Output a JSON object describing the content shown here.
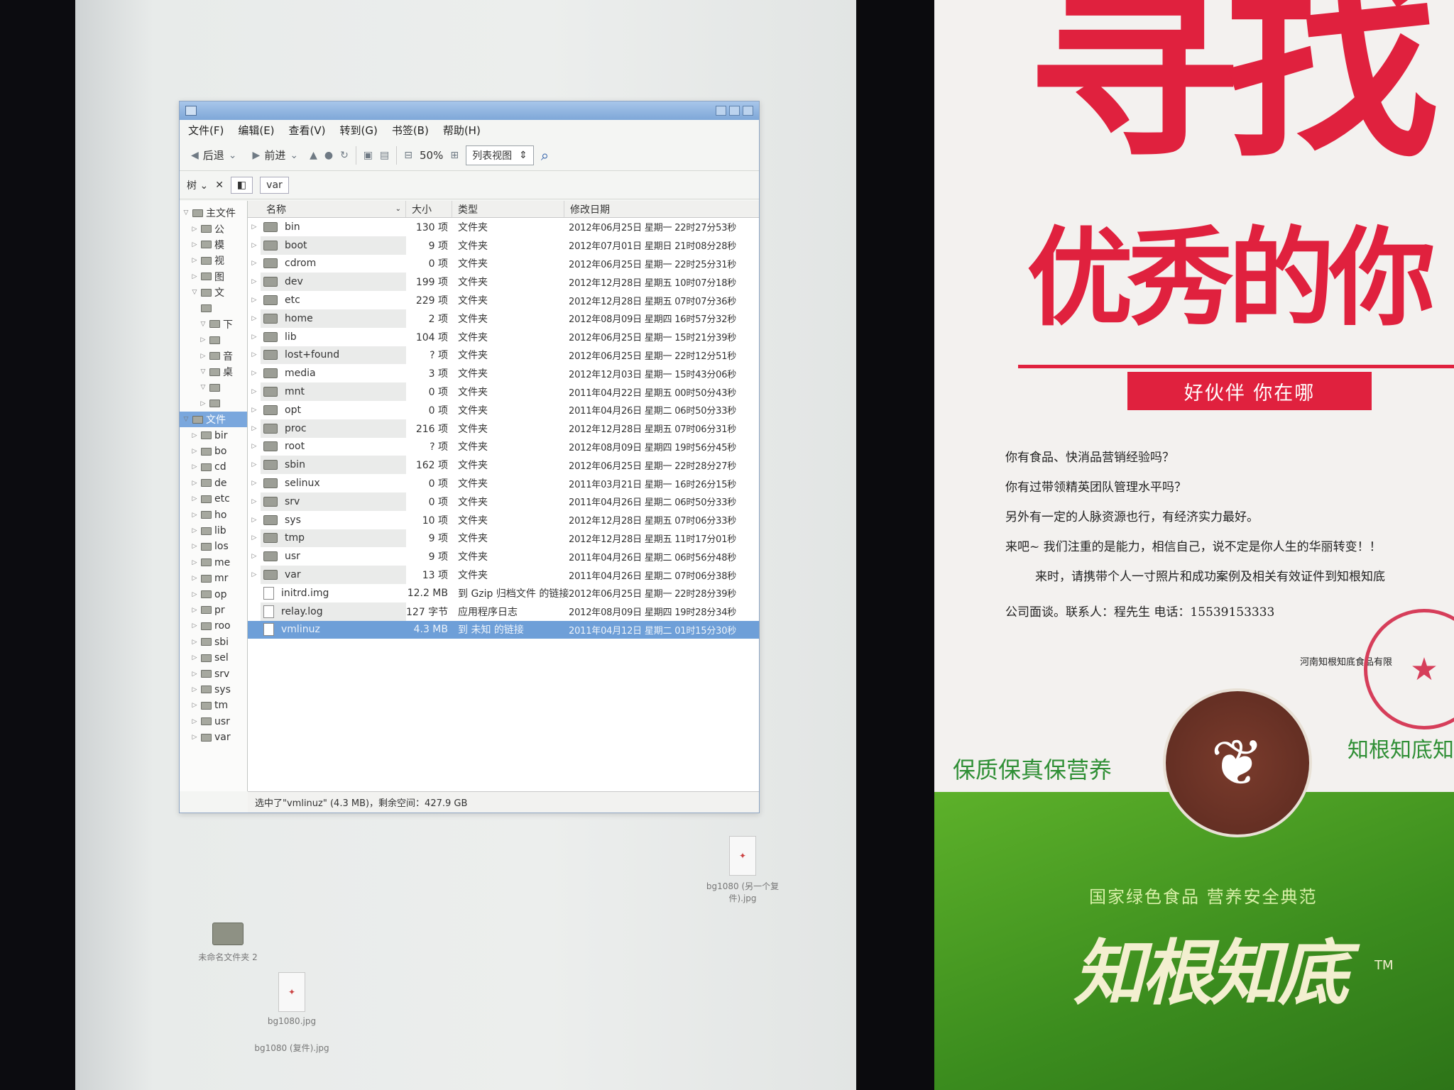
{
  "menubar": [
    "文件(F)",
    "编辑(E)",
    "查看(V)",
    "转到(G)",
    "书签(B)",
    "帮助(H)"
  ],
  "toolbar": {
    "back": "后退",
    "forward": "前进",
    "zoom": "50%",
    "view_mode": "列表视图"
  },
  "location": {
    "sidebar_mode": "树",
    "path": "var"
  },
  "tree": [
    {
      "label": "主文件",
      "expander": "▽"
    },
    {
      "label": "公",
      "expander": "▷"
    },
    {
      "label": "模",
      "expander": "▷"
    },
    {
      "label": "视",
      "expander": "▷"
    },
    {
      "label": "图",
      "expander": "▷"
    },
    {
      "label": "文",
      "expander": "▽"
    },
    {
      "label": "",
      "expander": ""
    },
    {
      "label": "下",
      "expander": "▽"
    },
    {
      "label": "",
      "expander": "▷"
    },
    {
      "label": "音",
      "expander": "▷"
    },
    {
      "label": "桌",
      "expander": "▽"
    },
    {
      "label": "",
      "expander": "▽"
    },
    {
      "label": "",
      "expander": "▷"
    },
    {
      "label": "文件",
      "expander": "▽"
    },
    {
      "label": "bir",
      "expander": "▷"
    },
    {
      "label": "bo",
      "expander": "▷"
    },
    {
      "label": "cd",
      "expander": "▷"
    },
    {
      "label": "de",
      "expander": "▷"
    },
    {
      "label": "etc",
      "expander": "▷"
    },
    {
      "label": "ho",
      "expander": "▷"
    },
    {
      "label": "lib",
      "expander": "▷"
    },
    {
      "label": "los",
      "expander": "▷"
    },
    {
      "label": "me",
      "expander": "▷"
    },
    {
      "label": "mr",
      "expander": "▷"
    },
    {
      "label": "op",
      "expander": "▷"
    },
    {
      "label": "pr",
      "expander": "▷"
    },
    {
      "label": "roo",
      "expander": "▷"
    },
    {
      "label": "sbi",
      "expander": "▷"
    },
    {
      "label": "sel",
      "expander": "▷"
    },
    {
      "label": "srv",
      "expander": "▷"
    },
    {
      "label": "sys",
      "expander": "▷"
    },
    {
      "label": "tm",
      "expander": "▷"
    },
    {
      "label": "usr",
      "expander": "▷"
    },
    {
      "label": "var",
      "expander": "▷"
    }
  ],
  "columns": {
    "name": "名称",
    "size": "大小",
    "type": "类型",
    "date": "修改日期"
  },
  "files": [
    {
      "name": "bin",
      "size": "130 项",
      "type": "文件夹",
      "date": "2012年06月25日 星期一 22时27分53秒"
    },
    {
      "name": "boot",
      "size": "9 项",
      "type": "文件夹",
      "date": "2012年07月01日 星期日 21时08分28秒"
    },
    {
      "name": "cdrom",
      "size": "0 项",
      "type": "文件夹",
      "date": "2012年06月25日 星期一 22时25分31秒"
    },
    {
      "name": "dev",
      "size": "199 项",
      "type": "文件夹",
      "date": "2012年12月28日 星期五 10时07分18秒"
    },
    {
      "name": "etc",
      "size": "229 项",
      "type": "文件夹",
      "date": "2012年12月28日 星期五 07时07分36秒"
    },
    {
      "name": "home",
      "size": "2 项",
      "type": "文件夹",
      "date": "2012年08月09日 星期四 16时57分32秒"
    },
    {
      "name": "lib",
      "size": "104 项",
      "type": "文件夹",
      "date": "2012年06月25日 星期一 15时21分39秒"
    },
    {
      "name": "lost+found",
      "size": "? 项",
      "type": "文件夹",
      "date": "2012年06月25日 星期一 22时12分51秒"
    },
    {
      "name": "media",
      "size": "3 项",
      "type": "文件夹",
      "date": "2012年12月03日 星期一 15时43分06秒"
    },
    {
      "name": "mnt",
      "size": "0 项",
      "type": "文件夹",
      "date": "2011年04月22日 星期五 00时50分43秒"
    },
    {
      "name": "opt",
      "size": "0 项",
      "type": "文件夹",
      "date": "2011年04月26日 星期二 06时50分33秒"
    },
    {
      "name": "proc",
      "size": "216 项",
      "type": "文件夹",
      "date": "2012年12月28日 星期五 07时06分31秒"
    },
    {
      "name": "root",
      "size": "? 项",
      "type": "文件夹",
      "date": "2012年08月09日 星期四 19时56分45秒"
    },
    {
      "name": "sbin",
      "size": "162 项",
      "type": "文件夹",
      "date": "2012年06月25日 星期一 22时28分27秒"
    },
    {
      "name": "selinux",
      "size": "0 项",
      "type": "文件夹",
      "date": "2011年03月21日 星期一 16时26分15秒"
    },
    {
      "name": "srv",
      "size": "0 项",
      "type": "文件夹",
      "date": "2011年04月26日 星期二 06时50分33秒"
    },
    {
      "name": "sys",
      "size": "10 项",
      "type": "文件夹",
      "date": "2012年12月28日 星期五 07时06分33秒"
    },
    {
      "name": "tmp",
      "size": "9 项",
      "type": "文件夹",
      "date": "2012年12月28日 星期五 11时17分01秒"
    },
    {
      "name": "usr",
      "size": "9 项",
      "type": "文件夹",
      "date": "2011年04月26日 星期二 06时56分48秒"
    },
    {
      "name": "var",
      "size": "13 项",
      "type": "文件夹",
      "date": "2011年04月26日 星期二 07时06分38秒"
    },
    {
      "name": "initrd.img",
      "size": "12.2 MB",
      "type": "到 Gzip 归档文件 的链接",
      "date": "2012年06月25日 星期一 22时28分39秒"
    },
    {
      "name": "relay.log",
      "size": "127 字节",
      "type": "应用程序日志",
      "date": "2012年08月09日 星期四 19时28分34秒"
    },
    {
      "name": "vmlinuz",
      "size": "4.3 MB",
      "type": "到 未知 的链接",
      "date": "2011年04月12日 星期二 01时15分30秒"
    }
  ],
  "status": "选中了\"vmlinuz\" (4.3 MB)，剩余空间：427.9 GB",
  "desktop_icons": {
    "bg1080_copy_other": "bg1080 (另一个复件).jpg",
    "folder_unnamed": "未命名文件夹 2",
    "bg1080": "bg1080.jpg",
    "bg1080_copy": "bg1080 (复件).jpg"
  },
  "poster": {
    "headline": "寻找",
    "subheadline": "优秀的你",
    "banner": "好伙伴  你在哪",
    "lines": [
      "你有食品、快消品营销经验吗？",
      "你有过带领精英团队管理水平吗？",
      "另外有一定的人脉资源也行，有经济实力最好。",
      "来吧~ 我们注重的是能力，相信自己，说不定是你人生的华丽转变！！",
      "来时，请携带个人一寸照片和成功案例及相关有效证件到知根知底",
      "公司面谈。联系人：程先生    电话：15539153333"
    ],
    "company_short": "河南知根知底食品有限",
    "motto_left": "保质保真保营养",
    "motto_right": "知根知底知",
    "slogan": "国家绿色食品  营养安全典范",
    "brand": "知根知底",
    "tm": "TM"
  },
  "colors": {
    "poster_red": "#e0213e",
    "selection_blue": "#6e9fd8",
    "poster_green": "#3b8c1e"
  }
}
